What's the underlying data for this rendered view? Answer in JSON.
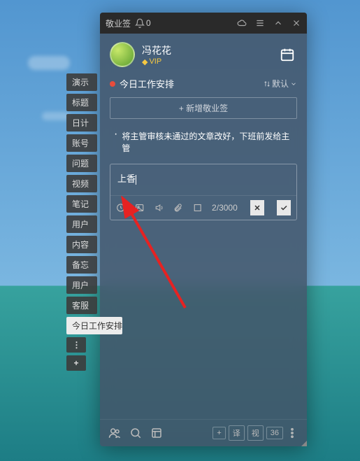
{
  "titlebar": {
    "app_name": "敬业签",
    "notif_count": "0"
  },
  "user": {
    "name": "冯花花",
    "vip_label": "VIP"
  },
  "section": {
    "title": "今日工作安排",
    "sort_label": "默认"
  },
  "add_button": "+ 新增敬业签",
  "notes": [
    "将主管审核未通过的文章改好，下班前发给主管"
  ],
  "input": {
    "value": "上香",
    "count": "2",
    "max": "3000"
  },
  "footer": {
    "plus": "+",
    "b1": "译",
    "b2": "视",
    "b3": "36"
  },
  "sidebar": {
    "items": [
      "演示",
      "标题",
      "日计",
      "账号",
      "问题",
      "视频",
      "笔记",
      "用户",
      "内容",
      "备忘",
      "用户",
      "客服"
    ],
    "active": "今日工作安排",
    "more": "⋮",
    "add": "+"
  }
}
